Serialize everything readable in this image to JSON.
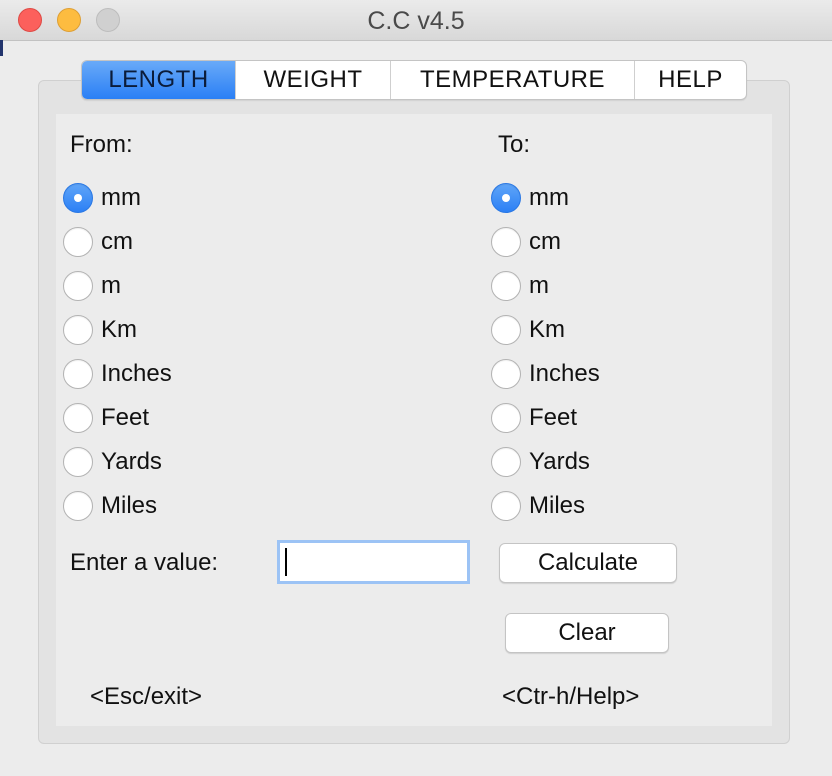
{
  "window": {
    "title": "C.C v4.5"
  },
  "tabs": [
    {
      "label": "LENGTH",
      "active": true
    },
    {
      "label": "WEIGHT",
      "active": false
    },
    {
      "label": "TEMPERATURE",
      "active": false
    },
    {
      "label": "HELP",
      "active": false
    }
  ],
  "from": {
    "label": "From:",
    "selected": "mm",
    "options": [
      "mm",
      "cm",
      "m",
      "Km",
      "Inches",
      "Feet",
      "Yards",
      "Miles"
    ]
  },
  "to": {
    "label": "To:",
    "selected": "mm",
    "options": [
      "mm",
      "cm",
      "m",
      "Km",
      "Inches",
      "Feet",
      "Yards",
      "Miles"
    ]
  },
  "input": {
    "label": "Enter a value:",
    "value": ""
  },
  "buttons": {
    "calculate": "Calculate",
    "clear": "Clear"
  },
  "hints": {
    "exit": "<Esc/exit>",
    "help": "<Ctr-h/Help>"
  },
  "colors": {
    "accent": "#2a7ff5",
    "close": "#fc605c",
    "minimize": "#fdbc40",
    "maximize_disabled": "#d0d0d0"
  }
}
